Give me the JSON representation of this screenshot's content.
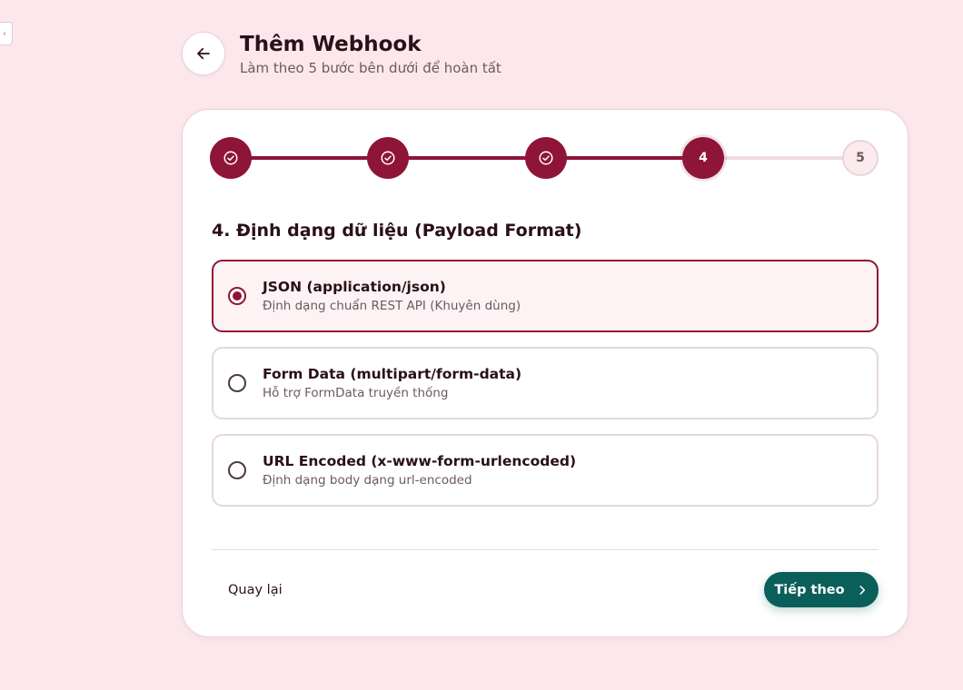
{
  "header": {
    "title": "Thêm Webhook",
    "subtitle": "Làm theo 5 bước bên dưới để hoàn tất"
  },
  "stepper": {
    "current_step": 4,
    "total_steps": 5,
    "steps": [
      {
        "label": "",
        "state": "done"
      },
      {
        "label": "",
        "state": "done"
      },
      {
        "label": "",
        "state": "done"
      },
      {
        "label": "4",
        "state": "active"
      },
      {
        "label": "5",
        "state": "pending"
      }
    ]
  },
  "section": {
    "title": "4. Định dạng dữ liệu (Payload Format)"
  },
  "options": [
    {
      "title": "JSON (application/json)",
      "desc": "Định dạng chuẩn REST API (Khuyên dùng)",
      "selected": true
    },
    {
      "title": "Form Data (multipart/form-data)",
      "desc": "Hỗ trợ FormData truyền thống",
      "selected": false
    },
    {
      "title": "URL Encoded (x-www-form-urlencoded)",
      "desc": "Định dạng body dạng url-encoded",
      "selected": false
    }
  ],
  "footer": {
    "back_label": "Quay lại",
    "next_label": "Tiếp theo"
  },
  "colors": {
    "primary": "#8e1538",
    "accent": "#0b5f5a",
    "background": "#fce8ec"
  }
}
